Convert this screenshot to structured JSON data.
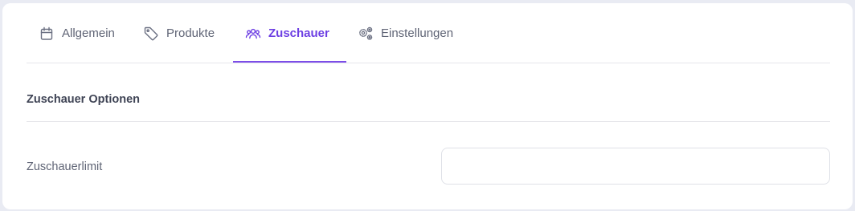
{
  "tabs": [
    {
      "label": "Allgemein",
      "icon": "calendar-icon",
      "active": false
    },
    {
      "label": "Produkte",
      "icon": "tag-icon",
      "active": false
    },
    {
      "label": "Zuschauer",
      "icon": "users-icon",
      "active": true
    },
    {
      "label": "Einstellungen",
      "icon": "gears-icon",
      "active": false
    }
  ],
  "section": {
    "title": "Zuschauer Optionen"
  },
  "fields": {
    "viewer_limit": {
      "label": "Zuschauerlimit",
      "value": "",
      "placeholder": ""
    }
  },
  "colors": {
    "accent": "#6d3fe3",
    "text": "#5f6475",
    "heading": "#3f4455",
    "page_bg": "#e9ebf3"
  }
}
